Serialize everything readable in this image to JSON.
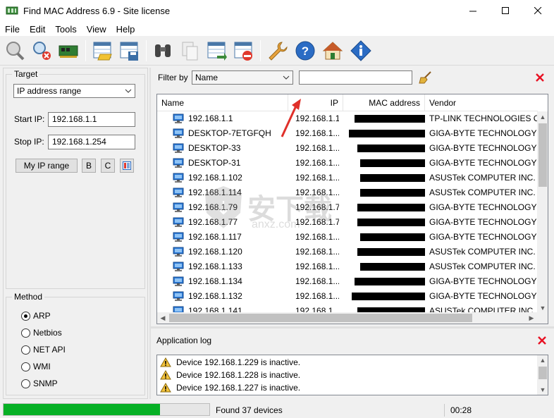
{
  "window": {
    "title": "Find MAC Address 6.9 - Site license"
  },
  "menu": [
    "File",
    "Edit",
    "Tools",
    "View",
    "Help"
  ],
  "toolbar": {
    "buttons": [
      "scan-icon",
      "stop-scan-icon",
      "network-card-icon",
      "open-icon",
      "save-icon",
      "find-icon",
      "copy-icon",
      "export-icon",
      "delete-icon",
      "settings-icon",
      "help-icon",
      "home-icon",
      "info-icon"
    ]
  },
  "target": {
    "legend": "Target",
    "mode": "IP address range",
    "start_label": "Start IP:",
    "start_value": "192.168.1.1",
    "stop_label": "Stop IP:",
    "stop_value": "192.168.1.254",
    "my_range_label": "My IP range",
    "b_label": "B",
    "c_label": "C"
  },
  "method": {
    "legend": "Method",
    "options": [
      "ARP",
      "Netbios",
      "NET API",
      "WMI",
      "SNMP"
    ],
    "selected": "ARP"
  },
  "filter": {
    "label": "Filter by",
    "field": "Name",
    "value": ""
  },
  "columns": [
    "Name",
    "IP",
    "MAC address",
    "Vendor"
  ],
  "rows": [
    {
      "name": "192.168.1.1",
      "ip": "192.168.1.1",
      "mac": "",
      "vendor": "TP-LINK TECHNOLOGIES CO.,LTD."
    },
    {
      "name": "DESKTOP-7ETGFQH",
      "ip": "192.168.1....",
      "mac": "",
      "vendor": "GIGA-BYTE TECHNOLOGY CO.,LTD."
    },
    {
      "name": "DESKTOP-33",
      "ip": "192.168.1....",
      "mac": "",
      "vendor": "GIGA-BYTE TECHNOLOGY CO.,LTD."
    },
    {
      "name": "DESKTOP-31",
      "ip": "192.168.1....",
      "mac": "",
      "vendor": "GIGA-BYTE TECHNOLOGY CO.,LTD."
    },
    {
      "name": "192.168.1.102",
      "ip": "192.168.1....",
      "mac": "",
      "vendor": "ASUSTek COMPUTER INC."
    },
    {
      "name": "192.168.1.114",
      "ip": "192.168.1....",
      "mac": "",
      "vendor": "ASUSTek COMPUTER INC."
    },
    {
      "name": "192.168.1.79",
      "ip": "192.168.1.79",
      "mac": "",
      "vendor": "GIGA-BYTE TECHNOLOGY CO.,LTD."
    },
    {
      "name": "192.168.1.77",
      "ip": "192.168.1.77",
      "mac": "",
      "vendor": "GIGA-BYTE TECHNOLOGY CO.,LTD."
    },
    {
      "name": "192.168.1.117",
      "ip": "192.168.1....",
      "mac": "",
      "vendor": "GIGA-BYTE TECHNOLOGY CO.,LTD."
    },
    {
      "name": "192.168.1.120",
      "ip": "192.168.1....",
      "mac": "",
      "vendor": "ASUSTek COMPUTER INC."
    },
    {
      "name": "192.168.1.133",
      "ip": "192.168.1....",
      "mac": "",
      "vendor": "ASUSTek COMPUTER INC."
    },
    {
      "name": "192.168.1.134",
      "ip": "192.168.1....",
      "mac": "",
      "vendor": "GIGA-BYTE TECHNOLOGY CO.,LTD."
    },
    {
      "name": "192.168.1.132",
      "ip": "192.168.1....",
      "mac": "",
      "vendor": "GIGA-BYTE TECHNOLOGY CO.,LTD."
    },
    {
      "name": "192.168.1.141",
      "ip": "192.168.1....",
      "mac": "",
      "vendor": "ASUSTek COMPUTER INC."
    }
  ],
  "log": {
    "title": "Application log",
    "entries": [
      "Device 192.168.1.229 is inactive.",
      "Device 192.168.1.228 is inactive.",
      "Device 192.168.1.227 is inactive."
    ]
  },
  "status": {
    "progress_percent": 76,
    "found": "Found 37 devices",
    "time": "00:28"
  },
  "watermark": {
    "text": "安下载",
    "subtext": "anxz.com"
  },
  "colors": {
    "progress": "#06b025",
    "close_red": "#e81123",
    "pc_blue": "#2b79d6"
  }
}
